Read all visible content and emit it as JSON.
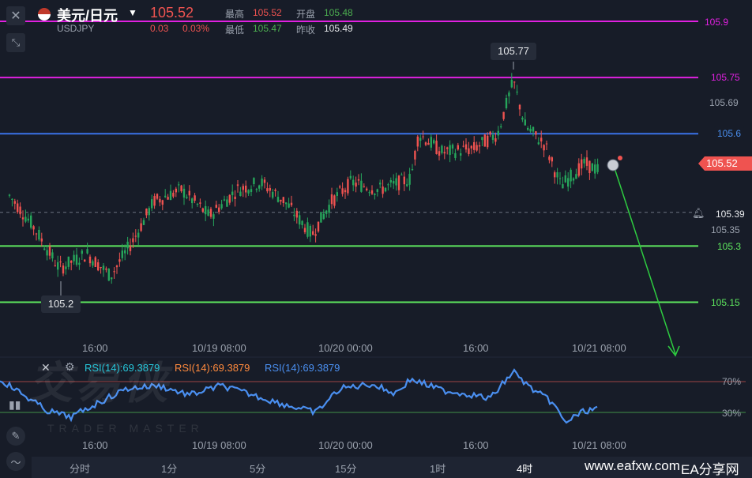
{
  "header": {
    "title": "美元/日元",
    "symbol": "USDJPY",
    "price": "105.52",
    "change": "0.03",
    "change_pct": "0.03%",
    "high_label": "最高",
    "high": "105.52",
    "open_label": "开盘",
    "open": "105.48",
    "low_label": "最低",
    "low": "105.47",
    "prev_label": "昨收",
    "prev": "105.49"
  },
  "price_axis": {
    "labels": [
      "105.69",
      "105.35"
    ],
    "levels": [
      {
        "value": "105.9",
        "color": "#e020e0"
      },
      {
        "value": "105.75",
        "color": "#e020e0"
      },
      {
        "value": "105.6",
        "color": "#3a72e8"
      },
      {
        "value": "105.3",
        "color": "#5ee85e"
      },
      {
        "value": "105.15",
        "color": "#5ee85e"
      }
    ],
    "current": "105.52",
    "alert": "105.39"
  },
  "annotations": {
    "peak": "105.77",
    "trough": "105.2"
  },
  "time_axis": [
    "16:00",
    "10/19 08:00",
    "10/20 00:00",
    "16:00",
    "10/21 08:00"
  ],
  "rsi": {
    "labels": [
      "RSI(14):69.3879",
      "RSI(14):69.3879",
      "RSI(14):69.3879"
    ],
    "colors": [
      "#26c6da",
      "#ff8a3d",
      "#4a8ff0"
    ],
    "levels": [
      "70%",
      "30%"
    ]
  },
  "timeframes": [
    "分时",
    "1分",
    "5分",
    "15分",
    "1时",
    "4时"
  ],
  "active_timeframe": "4时",
  "watermark": {
    "text": "交易侠",
    "sub": "TRADER MASTER"
  },
  "footer": {
    "site": "www.eafxw.com",
    "brand": "EA分享网"
  },
  "colors": {
    "up": "#26a65b",
    "down": "#ef5350",
    "rsi_line": "#4a8ff0",
    "bg": "#171c28"
  },
  "icons": [
    "close-icon",
    "flag-us-icon",
    "chevron-down-icon",
    "collapse-icon",
    "settings-icon",
    "pencil-icon",
    "indicator-icon",
    "bell-icon",
    "candle-icon"
  ]
}
